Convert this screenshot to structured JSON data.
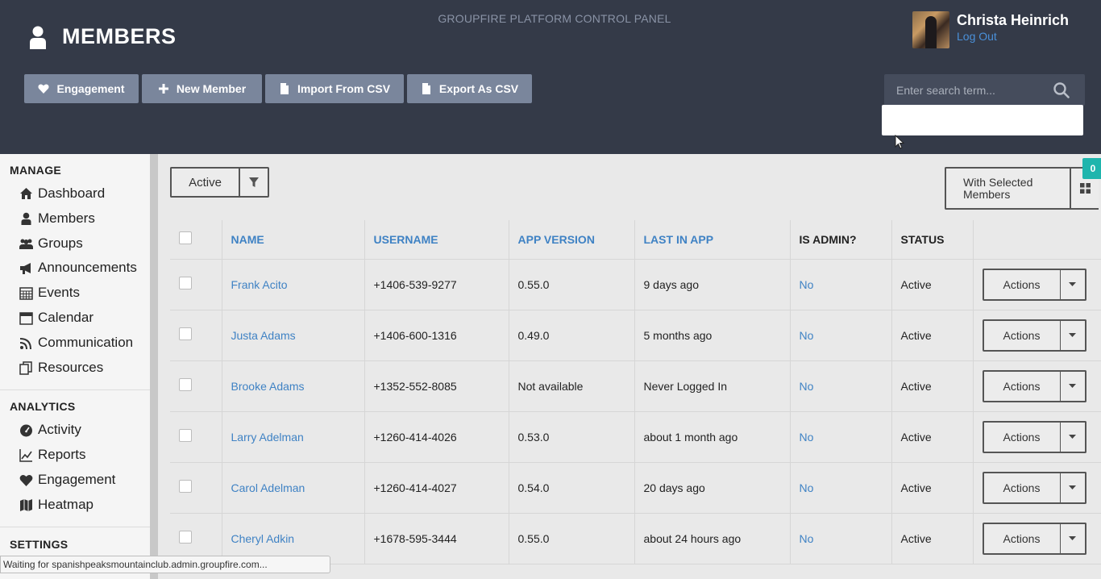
{
  "header": {
    "platform_title": "GROUPFIRE PLATFORM CONTROL PANEL",
    "page_title": "MEMBERS",
    "toolbar": {
      "engagement": "Engagement",
      "new_member": "New Member",
      "import_csv": "Import From CSV",
      "export_csv": "Export As CSV"
    },
    "user": {
      "name": "Christa Heinrich",
      "logout": "Log Out"
    },
    "search": {
      "placeholder": "Enter search term..."
    }
  },
  "sidebar": {
    "manage_title": "MANAGE",
    "manage_items": [
      {
        "label": "Dashboard",
        "icon": "home-icon"
      },
      {
        "label": "Members",
        "icon": "user-icon"
      },
      {
        "label": "Groups",
        "icon": "users-icon"
      },
      {
        "label": "Announcements",
        "icon": "bullhorn-icon"
      },
      {
        "label": "Events",
        "icon": "calendar-grid-icon"
      },
      {
        "label": "Calendar",
        "icon": "calendar-icon"
      },
      {
        "label": "Communication",
        "icon": "rss-icon"
      },
      {
        "label": "Resources",
        "icon": "files-icon"
      }
    ],
    "analytics_title": "ANALYTICS",
    "analytics_items": [
      {
        "label": "Activity",
        "icon": "dashboard-gauge-icon"
      },
      {
        "label": "Reports",
        "icon": "line-chart-icon"
      },
      {
        "label": "Engagement",
        "icon": "heart-icon"
      },
      {
        "label": "Heatmap",
        "icon": "map-icon"
      }
    ],
    "settings_title": "SETTINGS"
  },
  "main": {
    "filter_label": "Active",
    "with_selected_label": "With Selected Members",
    "selected_count": "0",
    "columns": [
      "NAME",
      "USERNAME",
      "APP VERSION",
      "LAST IN APP",
      "IS ADMIN?",
      "STATUS"
    ],
    "actions_label": "Actions",
    "rows": [
      {
        "name": "Frank Acito",
        "username": "+1406-539-9277",
        "app_version": "0.55.0",
        "last_in_app": "9 days ago",
        "is_admin": "No",
        "status": "Active"
      },
      {
        "name": "Justa Adams",
        "username": "+1406-600-1316",
        "app_version": "0.49.0",
        "last_in_app": "5 months ago",
        "is_admin": "No",
        "status": "Active"
      },
      {
        "name": "Brooke Adams",
        "username": "+1352-552-8085",
        "app_version": "Not available",
        "last_in_app": "Never Logged In",
        "is_admin": "No",
        "status": "Active"
      },
      {
        "name": "Larry Adelman",
        "username": "+1260-414-4026",
        "app_version": "0.53.0",
        "last_in_app": "about 1 month ago",
        "is_admin": "No",
        "status": "Active"
      },
      {
        "name": "Carol Adelman",
        "username": "+1260-414-4027",
        "app_version": "0.54.0",
        "last_in_app": "20 days ago",
        "is_admin": "No",
        "status": "Active"
      },
      {
        "name": "Cheryl Adkin",
        "username": "+1678-595-3444",
        "app_version": "0.55.0",
        "last_in_app": "about 24 hours ago",
        "is_admin": "No",
        "status": "Active"
      }
    ]
  },
  "statusbar": {
    "text": "Waiting for spanishpeaksmountainclub.admin.groupfire.com..."
  },
  "colors": {
    "header_bg": "#343a48",
    "button_bg": "#7a869c",
    "link": "#3f82c4",
    "badge": "#1fb5ad"
  }
}
